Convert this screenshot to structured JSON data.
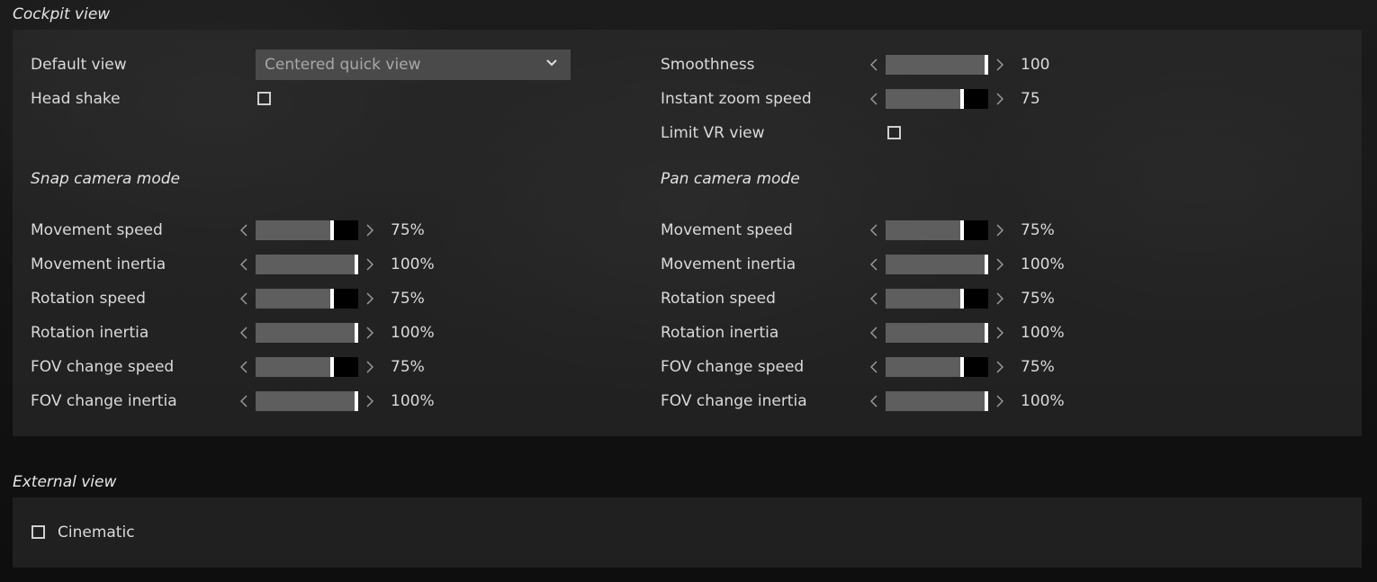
{
  "cockpit": {
    "title": "Cockpit view",
    "default_view": {
      "label": "Default view",
      "value": "Centered quick view"
    },
    "head_shake": {
      "label": "Head shake",
      "checked": false
    },
    "smoothness": {
      "label": "Smoothness",
      "value": "100",
      "level": 1.0
    },
    "instant_zoom": {
      "label": "Instant zoom speed",
      "value": "75",
      "level": 0.75
    },
    "limit_vr": {
      "label": "Limit VR view",
      "checked": false
    },
    "snap": {
      "title": "Snap camera mode",
      "rows": [
        {
          "label": "Movement speed",
          "value": "75%",
          "level": 0.75
        },
        {
          "label": "Movement inertia",
          "value": "100%",
          "level": 1.0
        },
        {
          "label": "Rotation speed",
          "value": "75%",
          "level": 0.75
        },
        {
          "label": "Rotation inertia",
          "value": "100%",
          "level": 1.0
        },
        {
          "label": "FOV change speed",
          "value": "75%",
          "level": 0.75
        },
        {
          "label": "FOV change inertia",
          "value": "100%",
          "level": 1.0
        }
      ]
    },
    "pan": {
      "title": "Pan camera mode",
      "rows": [
        {
          "label": "Movement speed",
          "value": "75%",
          "level": 0.75
        },
        {
          "label": "Movement inertia",
          "value": "100%",
          "level": 1.0
        },
        {
          "label": "Rotation speed",
          "value": "75%",
          "level": 0.75
        },
        {
          "label": "Rotation inertia",
          "value": "100%",
          "level": 1.0
        },
        {
          "label": "FOV change speed",
          "value": "75%",
          "level": 0.75
        },
        {
          "label": "FOV change inertia",
          "value": "100%",
          "level": 1.0
        }
      ]
    }
  },
  "external": {
    "title": "External view",
    "cinematic": {
      "label": "Cinematic",
      "checked": false
    }
  },
  "icons": {
    "dropdown": "chevron-down-icon",
    "decrease": "chevron-left-icon",
    "increase": "chevron-right-icon"
  },
  "colors": {
    "slider_fill": "#5e5e5e",
    "slider_track": "#000000",
    "slider_thumb": "#ffffff"
  }
}
